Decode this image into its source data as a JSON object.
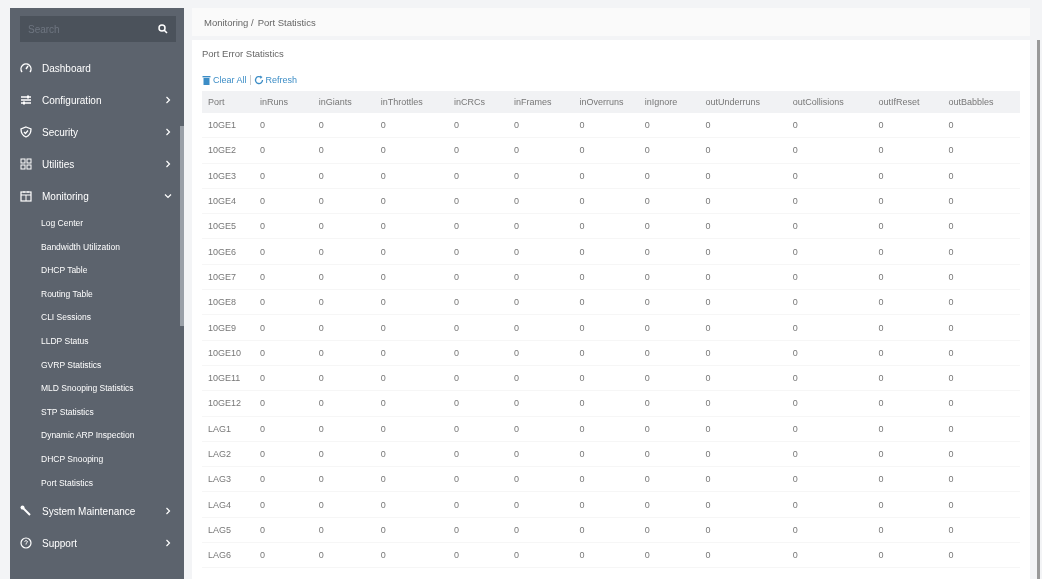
{
  "sidebar": {
    "search": {
      "placeholder": "Search"
    },
    "items": [
      {
        "label": "Dashboard"
      },
      {
        "label": "Configuration",
        "expanded": false
      },
      {
        "label": "Security",
        "expanded": false
      },
      {
        "label": "Utilities",
        "expanded": false
      },
      {
        "label": "Monitoring",
        "expanded": true,
        "children": [
          {
            "label": "Log Center"
          },
          {
            "label": "Bandwidth Utilization"
          },
          {
            "label": "DHCP Table"
          },
          {
            "label": "Routing Table"
          },
          {
            "label": "CLI Sessions"
          },
          {
            "label": "LLDP Status"
          },
          {
            "label": "GVRP Statistics"
          },
          {
            "label": "MLD Snooping Statistics"
          },
          {
            "label": "STP Statistics"
          },
          {
            "label": "Dynamic ARP Inspection"
          },
          {
            "label": "DHCP Snooping"
          },
          {
            "label": "Port Statistics"
          }
        ]
      },
      {
        "label": "System Maintenance",
        "expanded": false
      },
      {
        "label": "Support",
        "expanded": false
      }
    ]
  },
  "breadcrumb": [
    "Monitoring /",
    "Port Statistics"
  ],
  "panel": {
    "title": "Port Error Statistics",
    "actions": [
      {
        "label": "Clear All"
      },
      {
        "label": "Refresh"
      }
    ]
  },
  "table": {
    "columns": [
      "Port",
      "inRuns",
      "inGiants",
      "inThrottles",
      "inCRCs",
      "inFrames",
      "inOverruns",
      "inIgnore",
      "outUnderruns",
      "outCollisions",
      "outIfReset",
      "outBabbles"
    ],
    "rows": [
      [
        "10GE1",
        "0",
        "0",
        "0",
        "0",
        "0",
        "0",
        "0",
        "0",
        "0",
        "0",
        "0"
      ],
      [
        "10GE2",
        "0",
        "0",
        "0",
        "0",
        "0",
        "0",
        "0",
        "0",
        "0",
        "0",
        "0"
      ],
      [
        "10GE3",
        "0",
        "0",
        "0",
        "0",
        "0",
        "0",
        "0",
        "0",
        "0",
        "0",
        "0"
      ],
      [
        "10GE4",
        "0",
        "0",
        "0",
        "0",
        "0",
        "0",
        "0",
        "0",
        "0",
        "0",
        "0"
      ],
      [
        "10GE5",
        "0",
        "0",
        "0",
        "0",
        "0",
        "0",
        "0",
        "0",
        "0",
        "0",
        "0"
      ],
      [
        "10GE6",
        "0",
        "0",
        "0",
        "0",
        "0",
        "0",
        "0",
        "0",
        "0",
        "0",
        "0"
      ],
      [
        "10GE7",
        "0",
        "0",
        "0",
        "0",
        "0",
        "0",
        "0",
        "0",
        "0",
        "0",
        "0"
      ],
      [
        "10GE8",
        "0",
        "0",
        "0",
        "0",
        "0",
        "0",
        "0",
        "0",
        "0",
        "0",
        "0"
      ],
      [
        "10GE9",
        "0",
        "0",
        "0",
        "0",
        "0",
        "0",
        "0",
        "0",
        "0",
        "0",
        "0"
      ],
      [
        "10GE10",
        "0",
        "0",
        "0",
        "0",
        "0",
        "0",
        "0",
        "0",
        "0",
        "0",
        "0"
      ],
      [
        "10GE11",
        "0",
        "0",
        "0",
        "0",
        "0",
        "0",
        "0",
        "0",
        "0",
        "0",
        "0"
      ],
      [
        "10GE12",
        "0",
        "0",
        "0",
        "0",
        "0",
        "0",
        "0",
        "0",
        "0",
        "0",
        "0"
      ],
      [
        "LAG1",
        "0",
        "0",
        "0",
        "0",
        "0",
        "0",
        "0",
        "0",
        "0",
        "0",
        "0"
      ],
      [
        "LAG2",
        "0",
        "0",
        "0",
        "0",
        "0",
        "0",
        "0",
        "0",
        "0",
        "0",
        "0"
      ],
      [
        "LAG3",
        "0",
        "0",
        "0",
        "0",
        "0",
        "0",
        "0",
        "0",
        "0",
        "0",
        "0"
      ],
      [
        "LAG4",
        "0",
        "0",
        "0",
        "0",
        "0",
        "0",
        "0",
        "0",
        "0",
        "0",
        "0"
      ],
      [
        "LAG5",
        "0",
        "0",
        "0",
        "0",
        "0",
        "0",
        "0",
        "0",
        "0",
        "0",
        "0"
      ],
      [
        "LAG6",
        "0",
        "0",
        "0",
        "0",
        "0",
        "0",
        "0",
        "0",
        "0",
        "0",
        "0"
      ]
    ]
  }
}
